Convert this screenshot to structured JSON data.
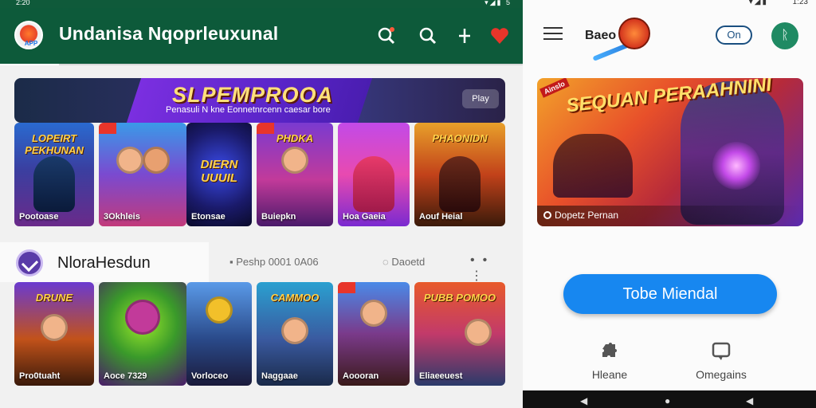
{
  "left": {
    "status": {
      "time": "2:20",
      "icons": "▾◢▮ 5"
    },
    "app": {
      "title": "Undanisa Nqoprleuxunal",
      "logo_text": "APP"
    },
    "banner": {
      "title": "SLPEMPROOA",
      "subtitle": "Penasuli N kne Eonnetnrcenn caesar bore",
      "button_label": "Play"
    },
    "row1": [
      {
        "caption": "Pootoase",
        "title": "LOPEIRT PEKHUNAN"
      },
      {
        "caption": "3Okhleis",
        "title": ""
      },
      {
        "caption": "Etonsae",
        "title": "DIERN UUUIL"
      },
      {
        "caption": "Buiepkn",
        "title": "PHDKA"
      },
      {
        "caption": "Hoa Gaeia",
        "title": ""
      },
      {
        "caption": "Aouf Heial",
        "title": "PHAONIDN"
      }
    ],
    "section": {
      "title": "NloraHesdun",
      "meta1": "Peshp 0001 0A06",
      "meta2": "Daoetd",
      "more": "•• ⋮"
    },
    "row2": [
      {
        "caption": "Pro0tuaht",
        "title": "DRUNE"
      },
      {
        "caption": "Aoce 7329",
        "title": ""
      },
      {
        "caption": "Vorloceo",
        "title": ""
      },
      {
        "caption": "Naggaae",
        "title": "CAMMOO"
      },
      {
        "caption": "Aoooran",
        "title": ""
      },
      {
        "caption": "Eliaeeuest",
        "title": "PUBB POMOO"
      }
    ],
    "colors": {
      "appbar": "#0d5a3a",
      "accent": "#7b2fe0"
    }
  },
  "right": {
    "status": {
      "icons": "▾◢▮",
      "time": "1:23"
    },
    "brand": {
      "text": "Baeo"
    },
    "toggle_label": "On",
    "profile_initial": "ᚱ",
    "promo": {
      "title": "SEQUAN PERAAHNINI",
      "tag": "Ainslo",
      "caption": "Dopetz Pernan"
    },
    "cta_label": "Tobe Miendal",
    "nav": [
      {
        "label": "Hleane",
        "icon": "puzzle-icon"
      },
      {
        "label": "Omegains",
        "icon": "chat-bubble-icon"
      }
    ],
    "colors": {
      "cta": "#1787f0",
      "profile": "#1f8a63"
    }
  }
}
